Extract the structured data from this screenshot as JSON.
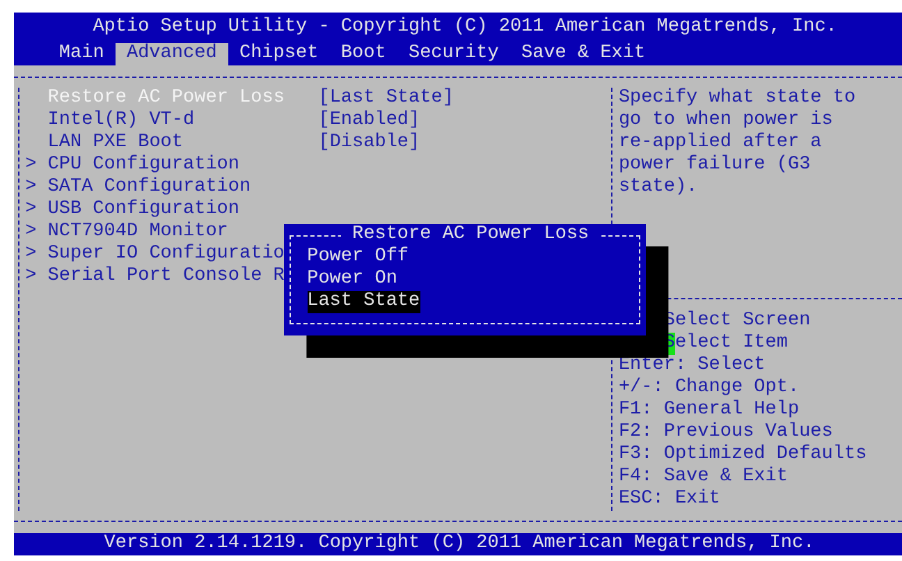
{
  "title": "Aptio Setup Utility - Copyright (C) 2011 American Megatrends, Inc.",
  "tabs": [
    {
      "label": "Main",
      "selected": false
    },
    {
      "label": "Advanced",
      "selected": true
    },
    {
      "label": "Chipset",
      "selected": false
    },
    {
      "label": "Boot",
      "selected": false
    },
    {
      "label": "Security",
      "selected": false
    },
    {
      "label": "Save & Exit",
      "selected": false
    }
  ],
  "items": [
    {
      "kind": "setting",
      "label": "Restore AC Power Loss",
      "value": "[Last State]",
      "selected": true
    },
    {
      "kind": "setting",
      "label": "Intel(R) VT-d",
      "value": "[Enabled]",
      "selected": false
    },
    {
      "kind": "setting",
      "label": "LAN PXE Boot",
      "value": "[Disable]",
      "selected": false
    },
    {
      "kind": "submenu",
      "marker": ">",
      "label": "CPU Configuration",
      "selected": false
    },
    {
      "kind": "submenu",
      "marker": ">",
      "label": "SATA Configuration",
      "selected": false
    },
    {
      "kind": "submenu",
      "marker": ">",
      "label": "USB Configuration",
      "selected": false
    },
    {
      "kind": "submenu",
      "marker": ">",
      "label": "NCT7904D Monitor",
      "selected": false
    },
    {
      "kind": "submenu",
      "marker": ">",
      "label": "Super IO Configuratio",
      "selected": false
    },
    {
      "kind": "submenu",
      "marker": ">",
      "label": "Serial Port Console R",
      "selected": false
    }
  ],
  "help_text": "Specify what state to go to when power is re-applied after a power failure (G3 state).",
  "key_help": [
    {
      "kind": "arrows",
      "text": "Select Screen",
      "cursor": false
    },
    {
      "kind": "arrows",
      "text": "Select Item",
      "cursor": true
    },
    {
      "kind": "key",
      "text": "Enter: Select",
      "cursor": false
    },
    {
      "kind": "key",
      "text": "+/-: Change Opt.",
      "cursor": false
    },
    {
      "kind": "key",
      "text": "F1: General Help",
      "cursor": false
    },
    {
      "kind": "key",
      "text": "F2: Previous Values",
      "cursor": false
    },
    {
      "kind": "key",
      "text": "F3: Optimized Defaults",
      "cursor": false
    },
    {
      "kind": "key",
      "text": "F4: Save & Exit",
      "cursor": false
    },
    {
      "kind": "key",
      "text": "ESC: Exit",
      "cursor": false
    }
  ],
  "popup": {
    "title": "Restore AC Power Loss",
    "options": [
      {
        "label": "Power Off",
        "selected": false
      },
      {
        "label": "Power On",
        "selected": false
      },
      {
        "label": "Last State",
        "selected": true
      }
    ]
  },
  "footer": "Version 2.14.1219. Copyright (C) 2011 American Megatrends, Inc."
}
